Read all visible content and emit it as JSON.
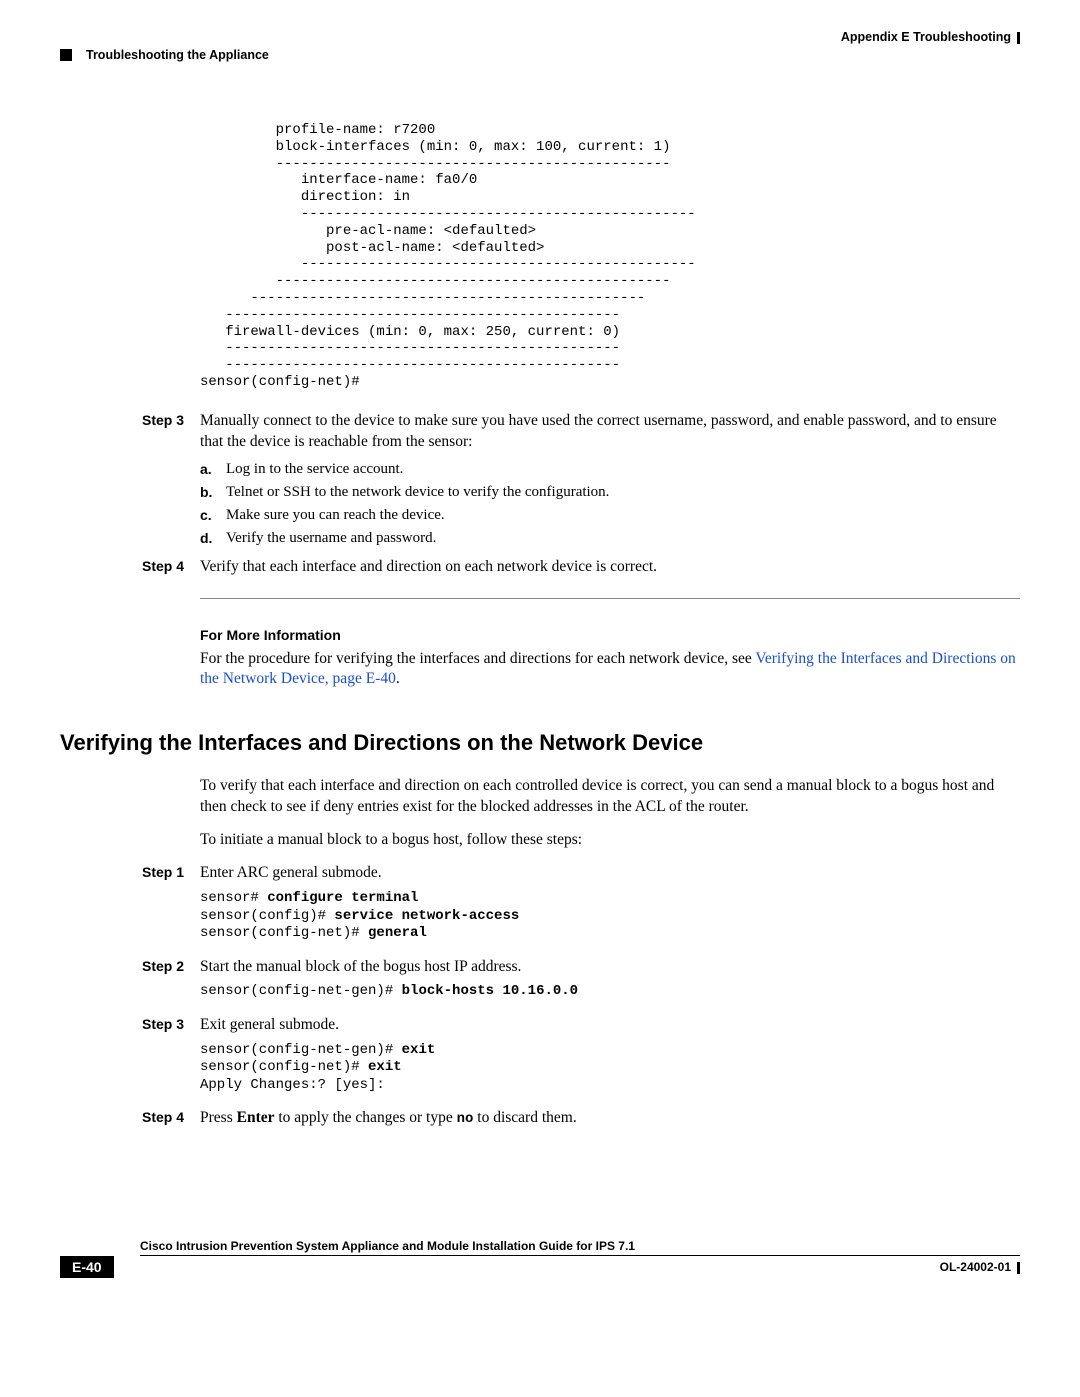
{
  "header": {
    "right": "Appendix E      Troubleshooting",
    "left": "Troubleshooting the Appliance"
  },
  "code_block": "         profile-name: r7200\n         block-interfaces (min: 0, max: 100, current: 1)\n         -----------------------------------------------\n            interface-name: fa0/0\n            direction: in\n            -----------------------------------------------\n               pre-acl-name: <defaulted>\n               post-acl-name: <defaulted>\n            -----------------------------------------------\n         -----------------------------------------------\n      -----------------------------------------------\n   -----------------------------------------------\n   firewall-devices (min: 0, max: 250, current: 0)\n   -----------------------------------------------\n   -----------------------------------------------\nsensor(config-net)#",
  "steps_a": [
    {
      "label": "Step 3",
      "text": "Manually connect to the device to make sure you have used the correct username, password, and enable password, and to ensure that the device is reachable from the sensor:",
      "subs": [
        {
          "letter": "a.",
          "text": "Log in to the service account."
        },
        {
          "letter": "b.",
          "text": "Telnet or SSH to the network device to verify the configuration."
        },
        {
          "letter": "c.",
          "text": "Make sure you can reach the device."
        },
        {
          "letter": "d.",
          "text": "Verify the username and password."
        }
      ]
    },
    {
      "label": "Step 4",
      "text": "Verify that each interface and direction on each network device is correct."
    }
  ],
  "fmi": {
    "heading": "For More Information",
    "pre": "For the procedure for verifying the interfaces and directions for each network device, see ",
    "link": "Verifying the Interfaces and Directions on the Network Device, page E-40",
    "post": "."
  },
  "section_heading": "Verifying the Interfaces and Directions on the Network Device",
  "intro_paras": [
    "To verify that each interface and direction on each controlled device is correct, you can send a manual block to a bogus host and then check to see if deny entries exist for the blocked addresses in the ACL of the router.",
    "To initiate a manual block to a bogus host, follow these steps:"
  ],
  "steps_b": [
    {
      "label": "Step 1",
      "text": "Enter ARC general submode.",
      "code_lines": [
        {
          "prompt": "sensor# ",
          "cmd": "configure terminal"
        },
        {
          "prompt": "sensor(config)# ",
          "cmd": "service network-access"
        },
        {
          "prompt": "sensor(config-net)# ",
          "cmd": "general"
        }
      ]
    },
    {
      "label": "Step 2",
      "text": "Start the manual block of the bogus host IP address.",
      "code_lines": [
        {
          "prompt": "sensor(config-net-gen)# ",
          "cmd": "block-hosts 10.16.0.0"
        }
      ]
    },
    {
      "label": "Step 3",
      "text": "Exit general submode.",
      "code_lines": [
        {
          "prompt": "sensor(config-net-gen)# ",
          "cmd": "exit"
        },
        {
          "prompt": "sensor(config-net)# ",
          "cmd": "exit"
        },
        {
          "prompt": "Apply Changes:? [yes]:",
          "cmd": ""
        }
      ]
    }
  ],
  "step4": {
    "label": "Step 4",
    "pre": "Press ",
    "enter": "Enter",
    "mid": " to apply the changes or type ",
    "no": "no",
    "post": " to discard them."
  },
  "footer": {
    "title": "Cisco Intrusion Prevention System Appliance and Module Installation Guide for IPS 7.1",
    "page": "E-40",
    "doc": "OL-24002-01"
  }
}
